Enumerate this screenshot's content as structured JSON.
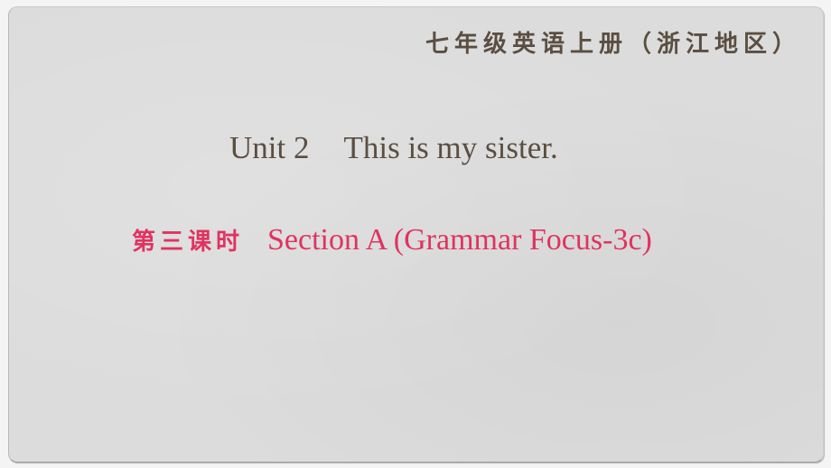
{
  "slide": {
    "header_title": "七年级英语上册（浙江地区）",
    "unit_label": "Unit 2",
    "unit_title": "This is my sister.",
    "lesson_cn": "第三课时",
    "lesson_en": "Section A (Grammar Focus-3c)"
  },
  "colors": {
    "primary_text": "#5a4e42",
    "accent_text": "#e03360",
    "slide_background": "#dcdcdc"
  }
}
